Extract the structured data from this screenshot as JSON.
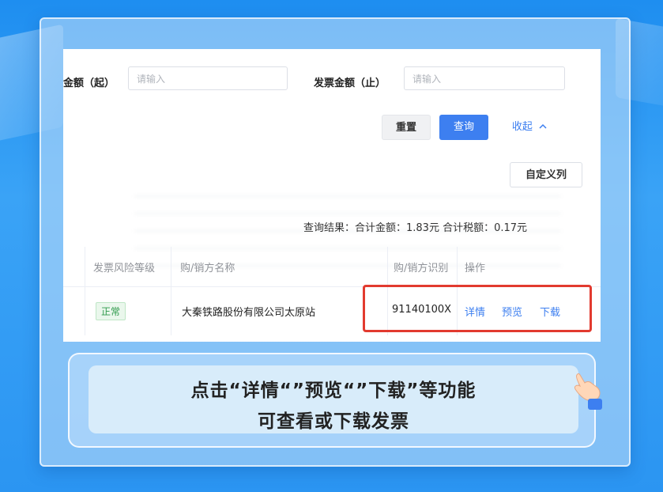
{
  "filters": {
    "amount_from_label": "金额（起）",
    "amount_from_placeholder": "请输入",
    "amount_to_label": "发票金额（止）",
    "amount_to_placeholder": "请输入"
  },
  "actions": {
    "reset": "重置",
    "query": "查询",
    "collapse": "收起",
    "custom_columns": "自定义列"
  },
  "summary": "查询结果：合计金额：1.83元    合计税额：0.17元",
  "table": {
    "headers": [
      "发票风险等级",
      "购/销方名称",
      "购/销方识别",
      "操作"
    ],
    "rows": [
      {
        "risk": "正常",
        "name": "大秦铁路股份有限公司太原站",
        "tax_id": "91140100X",
        "ops": [
          "详情",
          "预览",
          "下载"
        ]
      }
    ]
  },
  "caption": {
    "line1": "点击“详情“”预览“”下载”等功能",
    "line2": "可查看或下载发票"
  },
  "colors": {
    "accent": "#3d7ff0",
    "highlight": "#e23a2f",
    "status_ok": "#2e9a4b",
    "background": "#2b95f2"
  },
  "icons": [
    "chevron-up-icon",
    "pointing-hand-icon"
  ]
}
